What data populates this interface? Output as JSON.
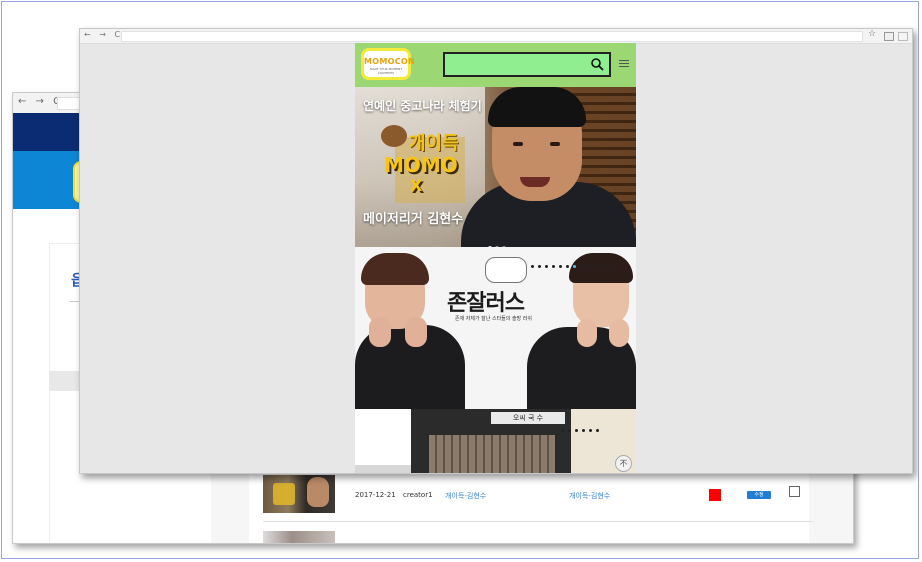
{
  "back_window": {
    "nav_glyphs": "← → C",
    "logo_glyph": "읍",
    "table_row": {
      "date": "2017-12-21",
      "creator": "creator1",
      "title_link": "개이득-김현수",
      "title_link_2": "개이득-김현수",
      "edit_label": "수정"
    }
  },
  "front_window": {
    "nav_glyphs": "← → C",
    "star_glyph": "☆"
  },
  "mobile": {
    "logo_text": "MOMOCON",
    "logo_sub": "MAKE YOUR MOMENT CONTENTS",
    "search_value": "",
    "banners": [
      {
        "top_caption": "연예인 중고나라 체험기",
        "title_line1": "개이득",
        "title_line2": "MOMO",
        "title_line3": "X",
        "bottom_caption": "메이저리거 김현수"
      },
      {
        "title": "존잘러스",
        "subtitle": "존재 자체가 잘난 스타들의 솔방 러쉬"
      },
      {
        "sign_text": "오씨 국 수"
      }
    ],
    "scroll_top_label": "不"
  }
}
